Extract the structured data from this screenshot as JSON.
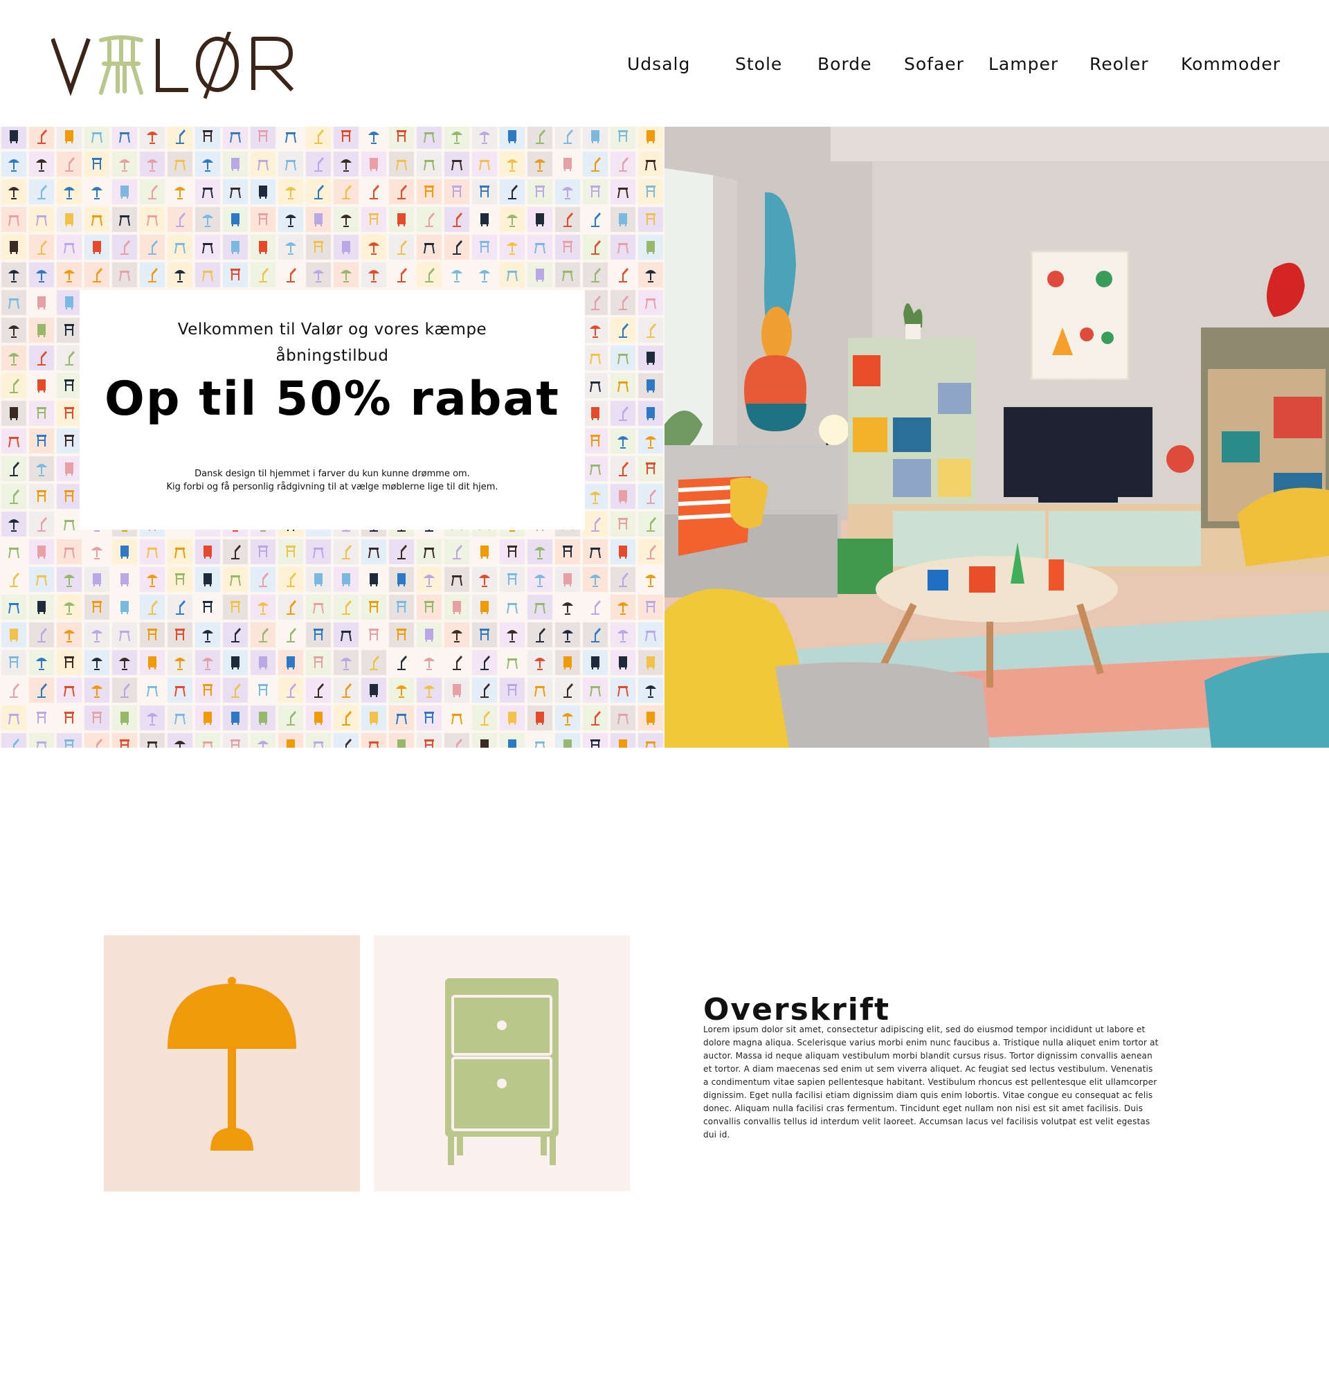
{
  "brand": {
    "name": "VALØR",
    "colors": {
      "brown": "#3b2418",
      "sage": "#b9c88a",
      "orange": "#f09a0a"
    }
  },
  "nav": {
    "items": [
      {
        "label": "Udsalg"
      },
      {
        "label": "Stole"
      },
      {
        "label": "Borde"
      },
      {
        "label": "Sofaer"
      },
      {
        "label": "Lamper"
      },
      {
        "label": "Reoler"
      },
      {
        "label": "Kommoder"
      }
    ]
  },
  "hero": {
    "pattern": {
      "icons": [
        "chair-icon",
        "lamp-icon",
        "desk-lamp-icon",
        "drawer-icon",
        "stool-icon"
      ]
    },
    "promo": {
      "intro_line1": "Velkommen til Valør og vores kæmpe",
      "intro_line2": "åbningstilbud",
      "headline": "Op til 50% rabat",
      "sub_line1": "Dansk design til hjemmet i farver du kun kunne drømme om.",
      "sub_line2": "Kig forbi og få personlig rådgivning til at vælge møblerne lige til dit hjem."
    },
    "room_image": {
      "icon": "living-room-photo"
    }
  },
  "feature": {
    "tiles": [
      {
        "icon": "lamp-icon",
        "color": "#f09a0a",
        "background": "#f7e2da"
      },
      {
        "icon": "drawer-icon",
        "color": "#b9c88a",
        "background": "#fcf1ef"
      }
    ],
    "title": "Overskrift",
    "body": "Lorem ipsum dolor sit amet, consectetur adipiscing elit, sed do eiusmod tempor incididunt ut labore et dolore magna aliqua. Scelerisque varius morbi enim nunc faucibus a. Tristique nulla aliquet enim tortor at auctor. Massa id neque aliquam vestibulum morbi blandit cursus risus. Tortor dignissim convallis aenean et tortor. A diam maecenas sed enim ut sem viverra aliquet. Ac feugiat sed lectus vestibulum. Venenatis a condimentum vitae sapien pellentesque habitant. Vestibulum rhoncus est pellentesque elit ullamcorper dignissim. Eget nulla facilisi etiam dignissim diam quis enim lobortis. Vitae congue eu consequat ac felis donec. Aliquam nulla facilisi cras fermentum. Tincidunt eget nullam non nisi est sit amet facilisis. Duis convallis convallis tellus id interdum velit laoreet. Accumsan lacus vel facilisis volutpat est velit egestas dui id."
  }
}
